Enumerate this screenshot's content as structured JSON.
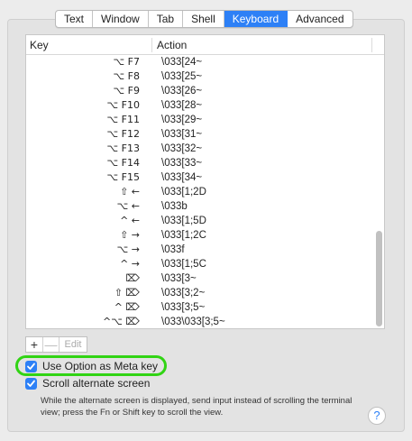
{
  "tabs": [
    {
      "label": "Text",
      "active": false
    },
    {
      "label": "Window",
      "active": false
    },
    {
      "label": "Tab",
      "active": false
    },
    {
      "label": "Shell",
      "active": false
    },
    {
      "label": "Keyboard",
      "active": true
    },
    {
      "label": "Advanced",
      "active": false
    }
  ],
  "table": {
    "headers": {
      "key": "Key",
      "action": "Action"
    },
    "rows": [
      {
        "key": "⌥ F7",
        "action": "\\033[24~"
      },
      {
        "key": "⌥ F8",
        "action": "\\033[25~"
      },
      {
        "key": "⌥ F9",
        "action": "\\033[26~"
      },
      {
        "key": "⌥ F10",
        "action": "\\033[28~"
      },
      {
        "key": "⌥ F11",
        "action": "\\033[29~"
      },
      {
        "key": "⌥ F12",
        "action": "\\033[31~"
      },
      {
        "key": "⌥ F13",
        "action": "\\033[32~"
      },
      {
        "key": "⌥ F14",
        "action": "\\033[33~"
      },
      {
        "key": "⌥ F15",
        "action": "\\033[34~"
      },
      {
        "key": "⇧ ←",
        "action": "\\033[1;2D"
      },
      {
        "key": "⌥ ←",
        "action": "\\033b"
      },
      {
        "key": "^ ←",
        "action": "\\033[1;5D"
      },
      {
        "key": "⇧ →",
        "action": "\\033[1;2C"
      },
      {
        "key": "⌥ →",
        "action": "\\033f"
      },
      {
        "key": "^ →",
        "action": "\\033[1;5C"
      },
      {
        "key": "⌦",
        "action": "\\033[3~"
      },
      {
        "key": "⇧ ⌦",
        "action": "\\033[3;2~"
      },
      {
        "key": "^ ⌦",
        "action": "\\033[3;5~"
      },
      {
        "key": "^⌥ ⌦",
        "action": "\\033\\033[3;5~"
      }
    ]
  },
  "buttons": {
    "add": "+",
    "remove": "—",
    "edit": "Edit"
  },
  "options": {
    "meta_key": {
      "label": "Use Option as Meta key",
      "checked": true
    },
    "scroll_alt": {
      "label": "Scroll alternate screen",
      "checked": true
    }
  },
  "help_text": "While the alternate screen is displayed, send input instead of scrolling the terminal view; press the Fn or Shift key to scroll the view.",
  "help_button": "?",
  "colors": {
    "accent": "#2d80f6",
    "highlight": "#31d414"
  }
}
